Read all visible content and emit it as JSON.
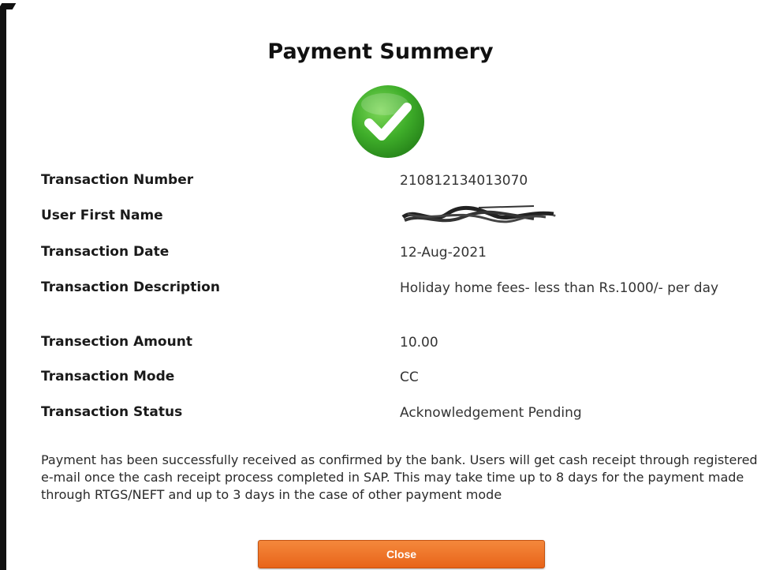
{
  "title": "Payment Summery",
  "icon": "check-circle-icon",
  "colors": {
    "success_green": "#3fae2a",
    "button_orange": "#ed6f22",
    "button_text": "#ffffff"
  },
  "details": [
    {
      "label": "Transaction Number",
      "value": "210812134013070"
    },
    {
      "label": "User First Name",
      "value": ""
    },
    {
      "label": "Transaction Date",
      "value": "12-Aug-2021"
    },
    {
      "label": "Transaction Description",
      "value": "Holiday home fees- less than Rs.1000/- per day"
    },
    {
      "label": "Transection Amount",
      "value": "10.00"
    },
    {
      "label": "Transaction Mode",
      "value": "CC"
    },
    {
      "label": "Transaction Status",
      "value": "Acknowledgement Pending"
    }
  ],
  "note": "Payment has been successfully received as confirmed by the bank. Users will get cash receipt through registered e-mail once the cash receipt process completed in SAP. This may take time up to 8 days for the payment made through RTGS/NEFT and up to 3 days in the case of other payment mode",
  "close_label": "Close"
}
